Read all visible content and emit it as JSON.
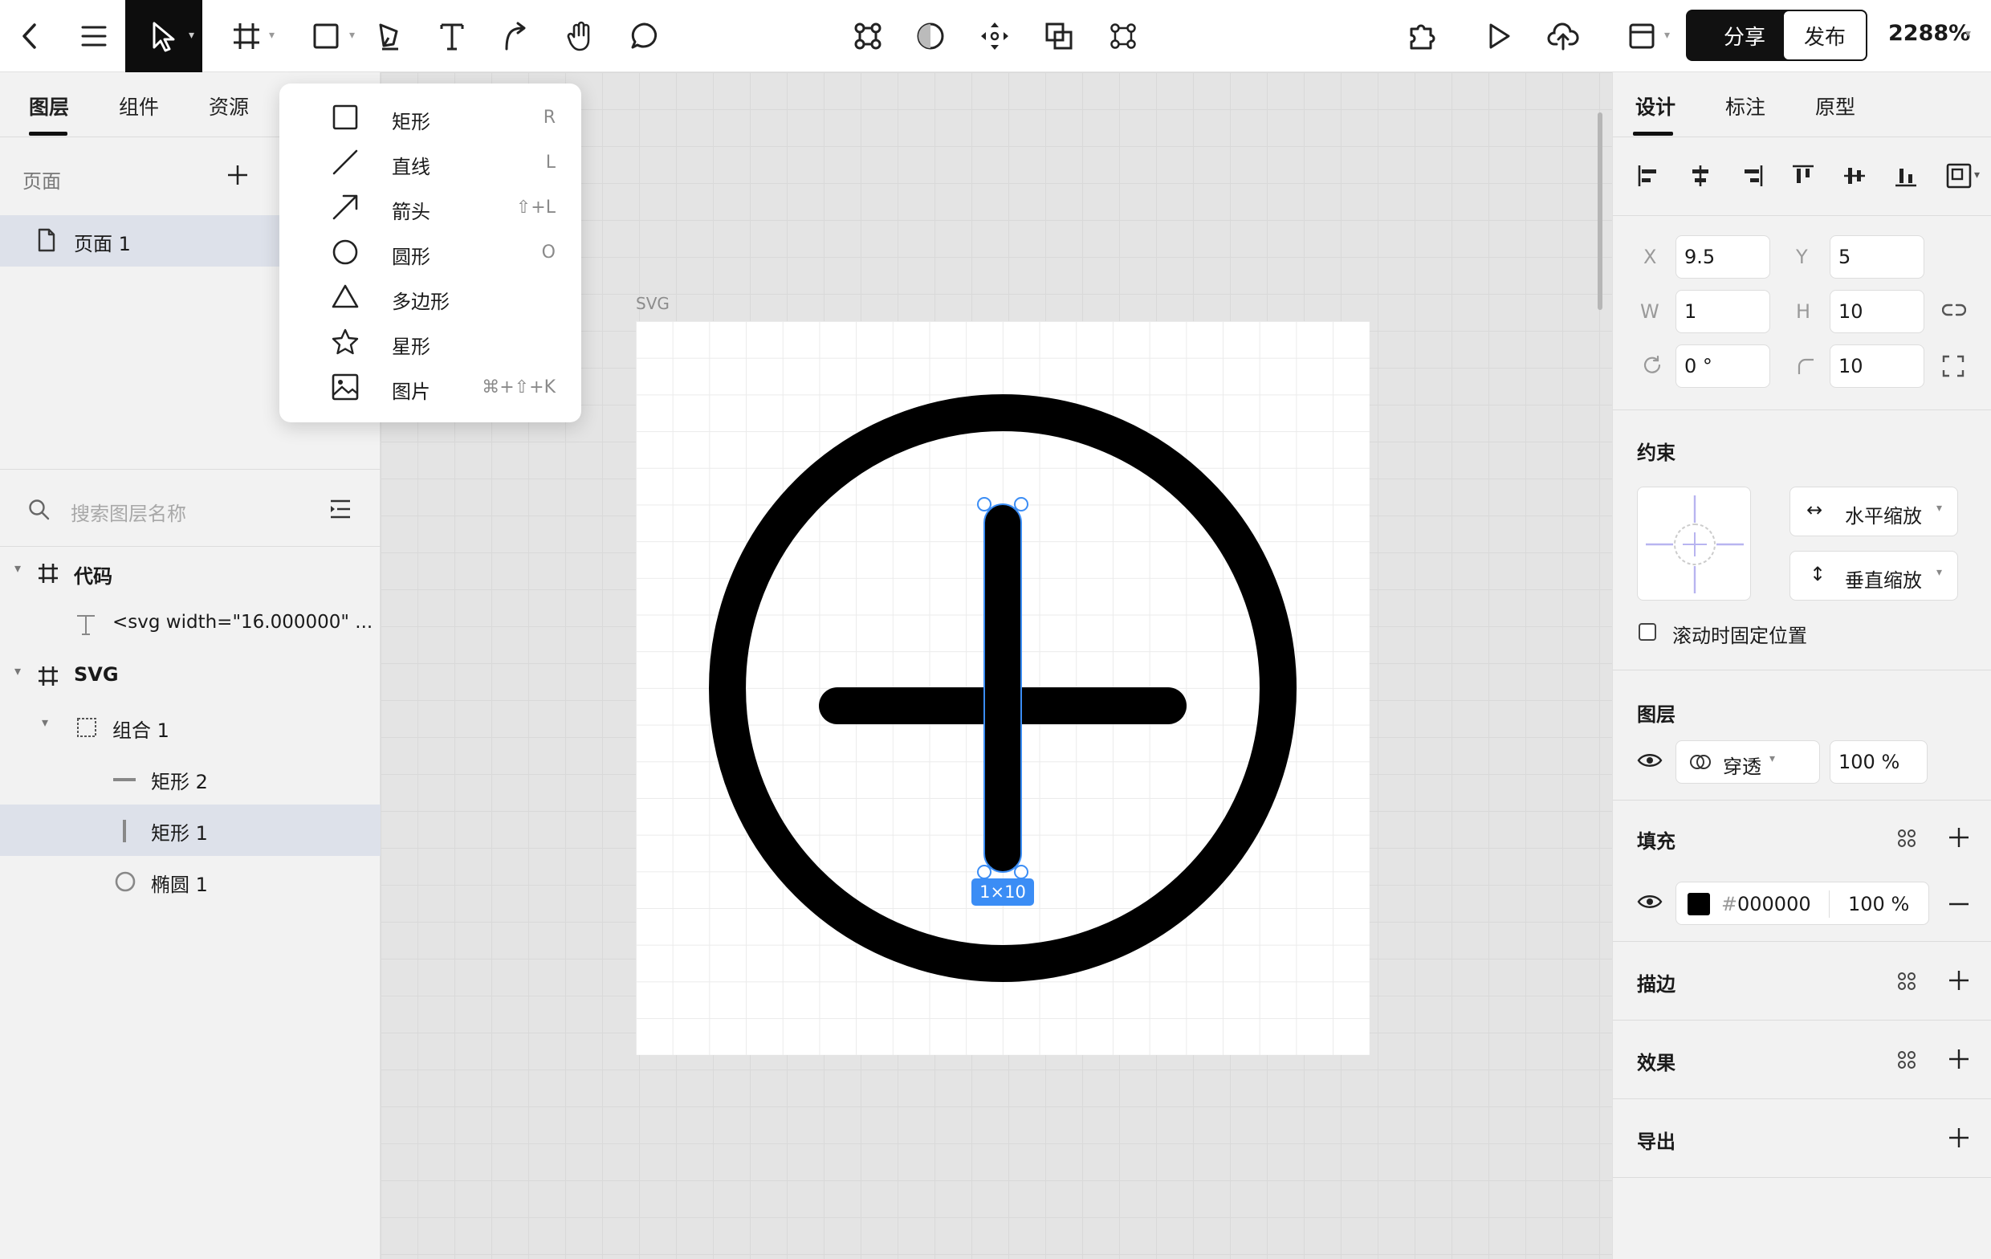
{
  "toolbar": {
    "share_label": "分享",
    "publish_label": "发布",
    "zoom": "2288%"
  },
  "left_panel": {
    "tabs": [
      {
        "label": "图层"
      },
      {
        "label": "组件"
      },
      {
        "label": "资源"
      }
    ],
    "pages_label": "页面",
    "pages": [
      {
        "label": "页面 1"
      }
    ],
    "search_placeholder": "搜索图层名称",
    "layers": [
      {
        "label": "代码"
      },
      {
        "label": "<svg width=\"16.000000\" ..."
      },
      {
        "label": "SVG"
      },
      {
        "label": "组合 1"
      },
      {
        "label": "矩形 2"
      },
      {
        "label": "矩形 1"
      },
      {
        "label": "椭圆 1"
      }
    ]
  },
  "shape_menu": {
    "items": [
      {
        "label": "矩形",
        "shortcut": "R"
      },
      {
        "label": "直线",
        "shortcut": "L"
      },
      {
        "label": "箭头",
        "shortcut": "⇧+L"
      },
      {
        "label": "圆形",
        "shortcut": "O"
      },
      {
        "label": "多边形",
        "shortcut": ""
      },
      {
        "label": "星形",
        "shortcut": ""
      },
      {
        "label": "图片",
        "shortcut": "⌘+⇧+K"
      }
    ]
  },
  "canvas": {
    "frame_label": "SVG",
    "selection_size": "1×10"
  },
  "right_panel": {
    "tabs": [
      {
        "label": "设计"
      },
      {
        "label": "标注"
      },
      {
        "label": "原型"
      }
    ],
    "x_label": "X",
    "x_value": "9.5",
    "y_label": "Y",
    "y_value": "5",
    "w_label": "W",
    "w_value": "1",
    "h_label": "H",
    "h_value": "10",
    "rotation_value": "0 °",
    "radius_value": "10",
    "constraints_title": "约束",
    "horizontal_constraint": "水平缩放",
    "vertical_constraint": "垂直缩放",
    "fix_on_scroll_label": "滚动时固定位置",
    "layer_title": "图层",
    "blend_mode": "穿透",
    "layer_opacity": "100 %",
    "fill_title": "填充",
    "fill_hex_prefix": "#",
    "fill_hex": "000000",
    "fill_opacity": "100 %",
    "stroke_title": "描边",
    "effects_title": "效果",
    "export_title": "导出"
  },
  "colors": {
    "selection_blue": "#3b8df5",
    "fill_color": "#000000"
  }
}
